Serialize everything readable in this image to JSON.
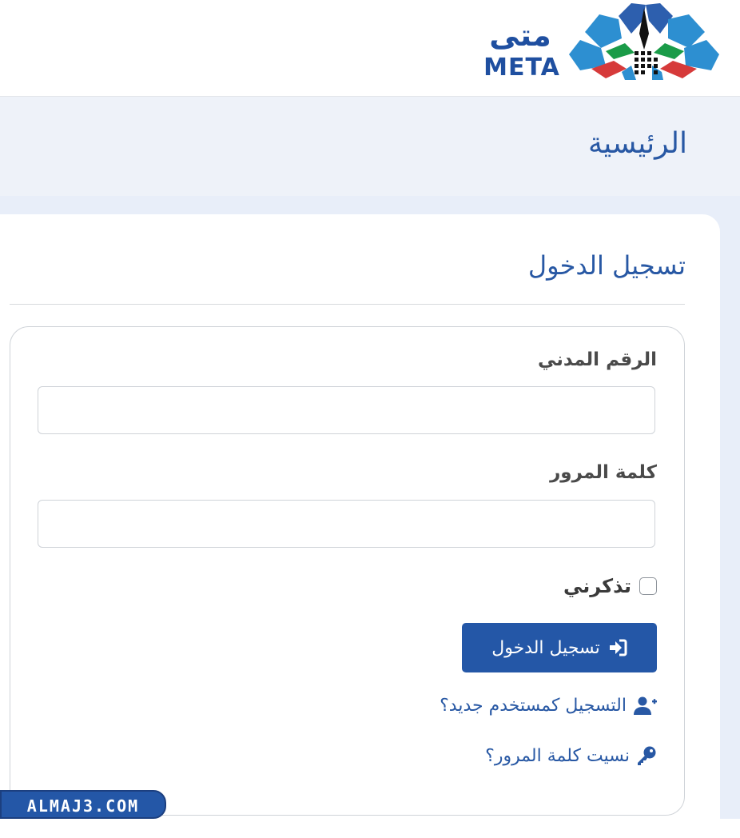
{
  "header": {
    "logo_ar": "متى",
    "logo_en": "META"
  },
  "page": {
    "title": "الرئيسية"
  },
  "login": {
    "heading": "تسجيل الدخول",
    "civil_id_label": "الرقم المدني",
    "civil_id_value": "",
    "password_label": "كلمة المرور",
    "password_value": "",
    "remember_label": "تذكرني",
    "remember_checked": false,
    "submit_label": "تسجيل الدخول",
    "register_link": "التسجيل كمستخدم جديد؟",
    "forgot_link": "نسيت كلمة المرور؟"
  },
  "watermark": {
    "text": "ALMAJ3.COM"
  },
  "icons": {
    "login": "sign-in-icon",
    "register": "user-plus-icon",
    "forgot": "key-icon"
  },
  "colors": {
    "brand_blue": "#2457a7",
    "text_blue": "#2858a4",
    "band_bg": "#eef2f9"
  }
}
